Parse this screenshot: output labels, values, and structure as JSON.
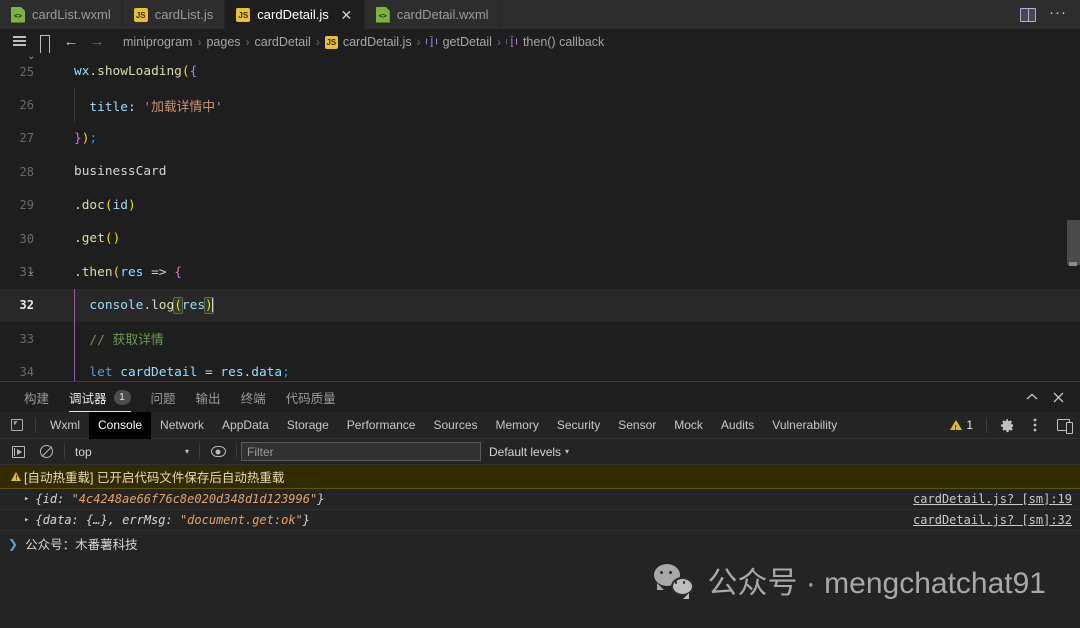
{
  "tabs": [
    {
      "label": "cardList.wxml",
      "icon": "wxml-file-icon",
      "active": false,
      "closable": false
    },
    {
      "label": "cardList.js",
      "icon": "js-file-icon",
      "active": false,
      "closable": false
    },
    {
      "label": "cardDetail.js",
      "icon": "js-file-icon",
      "active": true,
      "closable": true,
      "close_label": "✕"
    },
    {
      "label": "cardDetail.wxml",
      "icon": "wxml-file-icon",
      "active": false,
      "closable": false
    }
  ],
  "tabbar_actions": {
    "split_editor": "split-editor-icon",
    "more": "···"
  },
  "breadcrumb": {
    "tools": [
      "outline-icon",
      "bookmark-icon",
      "back-arrow-icon",
      "forward-arrow-icon"
    ],
    "back": "←",
    "forward": "→",
    "separator": "›",
    "items": [
      {
        "label": "miniprogram",
        "icon": null
      },
      {
        "label": "pages",
        "icon": null
      },
      {
        "label": "cardDetail",
        "icon": null
      },
      {
        "label": "cardDetail.js",
        "icon": "js-file-icon"
      },
      {
        "label": "getDetail",
        "icon": "symbol-method-icon"
      },
      {
        "label": "then() callback",
        "icon": "symbol-method-icon"
      }
    ]
  },
  "editor": {
    "language": "javascript",
    "active_line": 32,
    "lines": [
      {
        "num": "25",
        "fold": "⌄",
        "indent": false
      },
      {
        "num": "26",
        "fold": "",
        "indent": true
      },
      {
        "num": "27",
        "fold": "",
        "indent": false
      },
      {
        "num": "28",
        "fold": "",
        "indent": false
      },
      {
        "num": "29",
        "fold": "",
        "indent": false
      },
      {
        "num": "30",
        "fold": "",
        "indent": false
      },
      {
        "num": "31",
        "fold": "⌄",
        "indent": false
      },
      {
        "num": "32",
        "fold": "",
        "indent": false
      },
      {
        "num": "33",
        "fold": "",
        "indent": false
      },
      {
        "num": "34",
        "fold": "",
        "indent": false
      }
    ],
    "code": {
      "l25_a": "wx",
      "l25_b": ".",
      "l25_c": "showLoading",
      "l25_d": "(",
      "l25_e": "{",
      "l26_a": "  title",
      "l26_b": ": ",
      "l26_c": "'加载详情中'",
      "l27_a": "}",
      "l27_b": ")",
      "l27_c": ";",
      "l28_a": "businessCard",
      "l29_a": ".",
      "l29_b": "doc",
      "l29_c": "(",
      "l29_d": "id",
      "l29_e": ")",
      "l30_a": ".",
      "l30_b": "get",
      "l30_c": "(",
      "l30_d": ")",
      "l31_a": ".",
      "l31_b": "then",
      "l31_c": "(",
      "l31_d": "res",
      "l31_e": " => ",
      "l31_f": "{",
      "l32_a": "  console",
      "l32_b": ".",
      "l32_c": "log",
      "l32_d": "(",
      "l32_e": "res",
      "l32_f": ")",
      "l33_a": "  // 获取详情",
      "l34_a": "  let",
      "l34_b": " cardDetail ",
      "l34_c": "= ",
      "l34_d": "res",
      "l34_e": ".",
      "l34_f": "data",
      "l34_g": ";"
    }
  },
  "panel": {
    "tabs": [
      {
        "label": "构建",
        "active": false,
        "badge": null
      },
      {
        "label": "调试器",
        "active": true,
        "badge": "1"
      },
      {
        "label": "问题",
        "active": false,
        "badge": null
      },
      {
        "label": "输出",
        "active": false,
        "badge": null
      },
      {
        "label": "终端",
        "active": false,
        "badge": null
      },
      {
        "label": "代码质量",
        "active": false,
        "badge": null
      }
    ],
    "actions": {
      "collapse": "⌃",
      "close": "✕"
    }
  },
  "devtools": {
    "inspect_icon": "inspect-element-icon",
    "tabs": [
      {
        "label": "Wxml",
        "active": false
      },
      {
        "label": "Console",
        "active": true
      },
      {
        "label": "Network",
        "active": false
      },
      {
        "label": "AppData",
        "active": false
      },
      {
        "label": "Storage",
        "active": false
      },
      {
        "label": "Performance",
        "active": false
      },
      {
        "label": "Sources",
        "active": false
      },
      {
        "label": "Memory",
        "active": false
      },
      {
        "label": "Security",
        "active": false
      },
      {
        "label": "Sensor",
        "active": false
      },
      {
        "label": "Mock",
        "active": false
      },
      {
        "label": "Audits",
        "active": false
      },
      {
        "label": "Vulnerability",
        "active": false
      }
    ],
    "warning_count": "1",
    "right_icons": [
      "warning-icon",
      "settings-gear-icon",
      "more-options-icon",
      "dock-side-icon"
    ],
    "console_toolbar": {
      "execute_icon": "execute-sidebar-icon",
      "clear_icon": "clear-console-icon",
      "context": "top",
      "context_caret": "▾",
      "eye_icon": "live-expression-eye-icon",
      "filter_placeholder": "Filter",
      "filter_value": "",
      "levels": "Default levels",
      "levels_caret": "▾"
    },
    "messages": [
      {
        "type": "warning",
        "icon": "warning-triangle-icon",
        "text": "[自动热重载] 已开启代码文件保存后自动热重载",
        "source": null
      },
      {
        "type": "object",
        "disclosure": "▸",
        "open_brace": "{",
        "key1": "id: ",
        "val1": "\"4c4248ae66f76c8e020d348d1d123996\"",
        "close_brace": "}",
        "source": "cardDetail.js? [sm]:19"
      },
      {
        "type": "object2",
        "disclosure": "▸",
        "open_brace": "{",
        "key1": "data: ",
        "val1": "{…}",
        "key2": ", errMsg: ",
        "val2": "\"document.get:ok\"",
        "close_brace": "}",
        "source": "cardDetail.js? [sm]:32"
      }
    ],
    "prompt": {
      "chevron": "❯",
      "text": "公众号：木番薯科技"
    }
  },
  "watermark": {
    "logo": "wechat-logo",
    "text": "公众号 · mengchatchat91"
  },
  "colors": {
    "accent_purple": "#b180d7",
    "string_orange": "#ce9178",
    "comment_green": "#6a9955",
    "keyword_blue": "#569cd6",
    "function_yellow": "#dcdcaa",
    "warning_yellow": "#e2b93d",
    "editor_bg": "#1e1e1e",
    "panel_bg": "#242424"
  }
}
